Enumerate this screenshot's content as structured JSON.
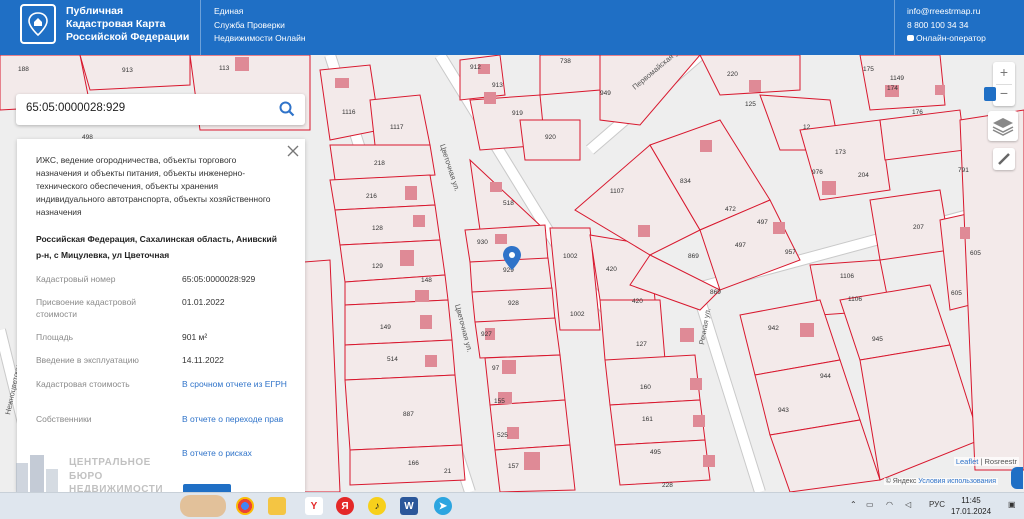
{
  "header": {
    "brand_title": "Публичная\nКадастровая Карта\nРоссийской Федерации",
    "service": "Единая\nСлужба Проверки\nНедвижимости Онлайн",
    "email": "info@rreestrmap.ru",
    "phone": "8 800 100 34 34",
    "operator": "Онлайн-оператор"
  },
  "search": {
    "value": "65:05:0000028:929"
  },
  "panel": {
    "purpose": "ИЖС, ведение огородничества, объекты торгового назначения и объекты питания, объекты инженерно-технического обеспечения, объекты хранения индивидуального автотранспорта, объекты хозяйственного назначения",
    "address": "Российская Федерация, Сахалинская область, Анивский р-н, с Мицулевка, ул Цветочная",
    "rows": [
      {
        "label": "Кадастровый номер",
        "value": "65:05:0000028:929"
      },
      {
        "label": "Присвоение кадастровой стоимости",
        "value": "01.01.2022"
      },
      {
        "label": "Площадь",
        "value": "901 м²"
      },
      {
        "label": "Введение в эксплуатацию",
        "value": "14.11.2022"
      },
      {
        "label": "Кадастровая стоимость",
        "value": "В срочном отчете из ЕГРН"
      },
      {
        "label": "Собственники",
        "value": "В отчете о переходе прав"
      },
      {
        "label": "",
        "value": "В отчете о рисках"
      }
    ]
  },
  "watermark": "ЦЕНТРАЛЬНОЕ\nБЮРО\nНЕДВИЖИМОСТИ",
  "map": {
    "streets": [
      "Цветочная ул.",
      "Цветочная ул.",
      "Первомайская ул.",
      "Речная ул.",
      "Нежноцветочная ул."
    ],
    "parcel_labels": [
      "188",
      "913",
      "113",
      "498",
      "1116",
      "1117",
      "218",
      "216",
      "128",
      "129",
      "148",
      "149",
      "514",
      "887",
      "166",
      "21",
      "912",
      "913",
      "919",
      "920",
      "738",
      "949",
      "518",
      "930",
      "929",
      "928",
      "927",
      "1002",
      "1002",
      "420",
      "420",
      "127",
      "160",
      "161",
      "495",
      "228",
      "97",
      "155",
      "525",
      "157",
      "1107",
      "834",
      "472",
      "497",
      "497",
      "869",
      "869",
      "957",
      "220",
      "125",
      "175",
      "174",
      "176",
      "12",
      "173",
      "204",
      "976",
      "207",
      "605",
      "605",
      "1106",
      "1106",
      "942",
      "945",
      "944",
      "943",
      "791",
      "1149"
    ]
  },
  "controls": {
    "zoom_in": "+",
    "zoom_out": "−"
  },
  "attribution": {
    "leaflet": "Leaflet",
    "rosreestr": "| Rosreestr",
    "yandex": "© Яндекс",
    "terms": "Условия использования"
  },
  "taskbar": {
    "lang": "РУС",
    "time": "11:45",
    "date": "17.01.2024"
  }
}
